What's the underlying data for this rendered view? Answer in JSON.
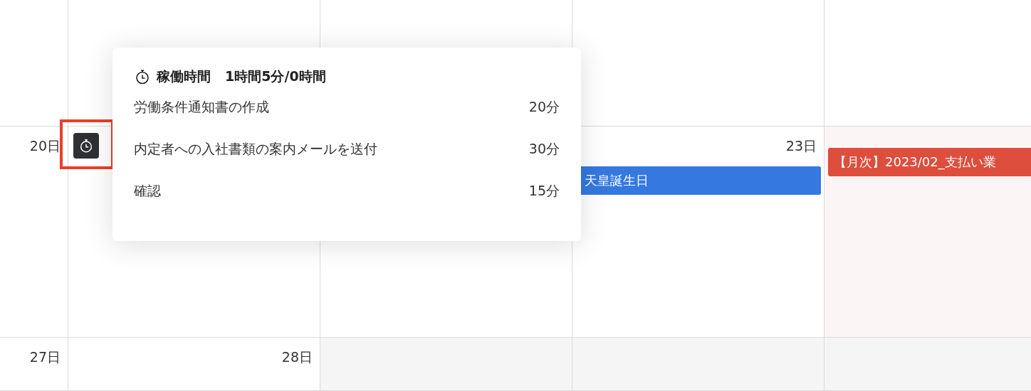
{
  "weeks": [
    {
      "days": [
        {
          "kind": "normal"
        },
        {
          "kind": "normal"
        },
        {
          "kind": "normal"
        },
        {
          "kind": "normal"
        },
        {
          "kind": "normal"
        }
      ]
    },
    {
      "days": [
        {
          "kind": "normal",
          "date": "20日"
        },
        {
          "kind": "normal",
          "timer": true,
          "highlighted": true
        },
        {
          "kind": "normal"
        },
        {
          "kind": "normal",
          "date": "23日",
          "events": [
            {
              "title": "天皇誕生日",
              "color": "#3478e0"
            }
          ]
        },
        {
          "kind": "holiday",
          "events": [
            {
              "title": "【月次】2023/02_支払い業",
              "color": "#dd4e3d"
            }
          ]
        }
      ]
    },
    {
      "days": [
        {
          "kind": "normal",
          "date": "27日"
        },
        {
          "kind": "normal",
          "date": "28日"
        },
        {
          "kind": "other_month"
        },
        {
          "kind": "other_month"
        },
        {
          "kind": "other_month"
        }
      ]
    }
  ],
  "popup": {
    "title": "稼働時間",
    "total": "1時間5分/0時間",
    "items": [
      {
        "name": "労働条件通知書の作成",
        "duration": "20分"
      },
      {
        "name": "内定者への入社書類の案内メールを送付",
        "duration": "30分"
      },
      {
        "name": "確認",
        "duration": "15分"
      }
    ]
  }
}
